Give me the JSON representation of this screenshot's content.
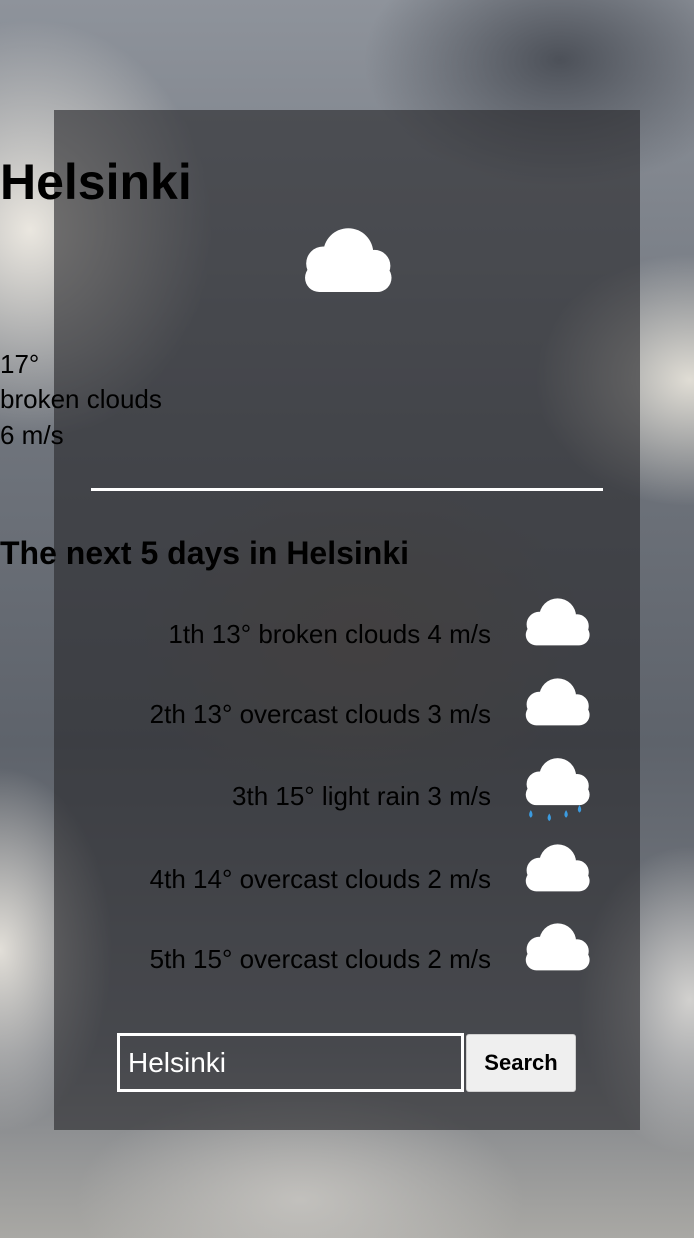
{
  "current": {
    "city": "Helsinki",
    "icon": "cloud-icon",
    "temperature": "17°",
    "description": "broken clouds",
    "wind": "6 m/s"
  },
  "forecast": {
    "title": "The next 5 days in Helsinki",
    "days": [
      {
        "text": "1th 13° broken clouds 4 m/s",
        "icon": "cloud-icon"
      },
      {
        "text": "2th 13° overcast clouds 3 m/s",
        "icon": "cloud-icon"
      },
      {
        "text": "3th 15° light rain 3 m/s",
        "icon": "rain-cloud-icon"
      },
      {
        "text": "4th 14° overcast clouds 2 m/s",
        "icon": "cloud-icon"
      },
      {
        "text": "5th 15° overcast clouds 2 m/s",
        "icon": "cloud-icon"
      }
    ]
  },
  "search": {
    "value": "Helsinki",
    "button_label": "Search"
  },
  "colors": {
    "text": "#ffffff",
    "card": "rgba(40,40,44,0.62)",
    "rain_drop": "#3b9be0"
  }
}
